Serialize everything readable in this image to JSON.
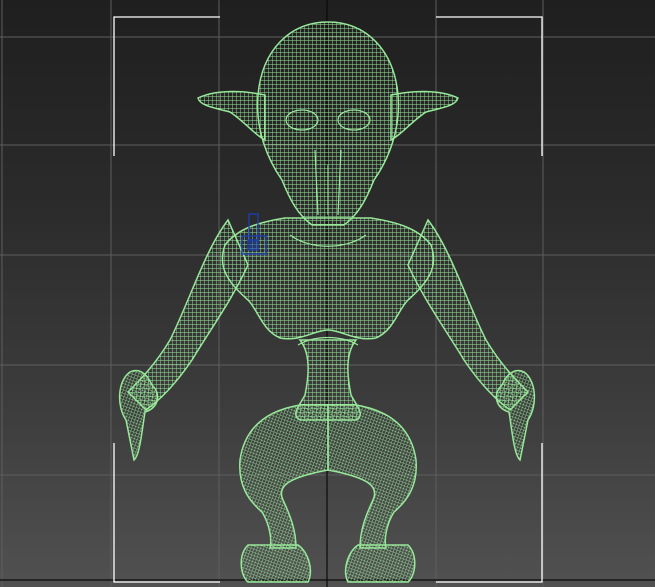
{
  "viewport": {
    "background_top": "#1f1f1f",
    "background_bottom": "#515151",
    "grid_color": "#5e5e5e",
    "axis_color": "#0a0a0a",
    "bracket_color": "#ffffff"
  },
  "model": {
    "wire_color": "#98e89a",
    "selection_color": "#1a3fb0",
    "icon": "wireframe-character"
  }
}
